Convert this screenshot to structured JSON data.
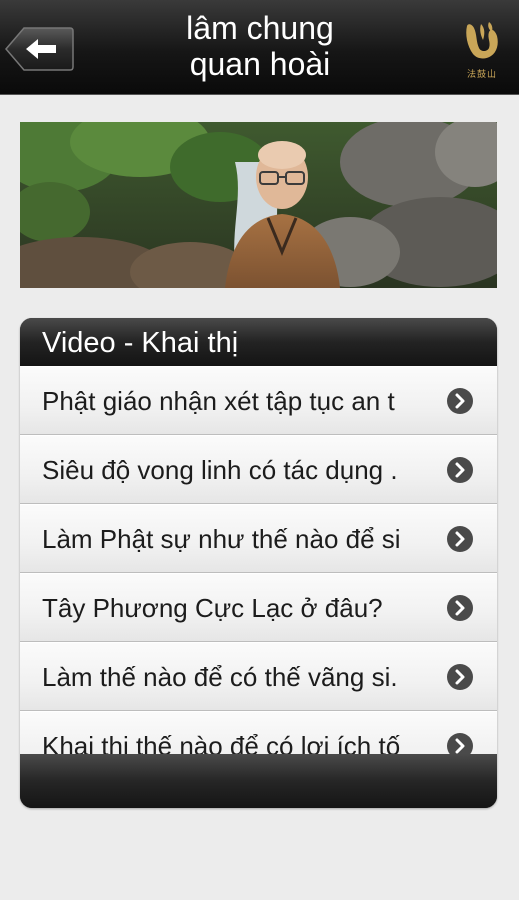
{
  "header": {
    "title_line1": "lâm chung",
    "title_line2": "quan hoài",
    "logo_text": "法鼓山"
  },
  "icons": {
    "back": "back-arrow-icon",
    "logo": "dharma-drum-logo-icon",
    "chevron": "chevron-right-icon"
  },
  "panel": {
    "title": "Video - Khai thị",
    "items": [
      {
        "label": "Phật giáo nhận xét tập tục an t"
      },
      {
        "label": "Siêu độ vong linh có tác dụng ."
      },
      {
        "label": "Làm Phật sự như thế nào để si"
      },
      {
        "label": "Tây Phương Cực Lạc ở đâu?"
      },
      {
        "label": "Làm thế nào để có thế vãng si."
      },
      {
        "label": "Khai thị thế nào để có lợi ích tố"
      }
    ]
  },
  "colors": {
    "header_bg": "#161616",
    "logo_gold": "#c9a658",
    "page_bg": "#ececec",
    "chevron_bg": "#4a4a4a"
  }
}
